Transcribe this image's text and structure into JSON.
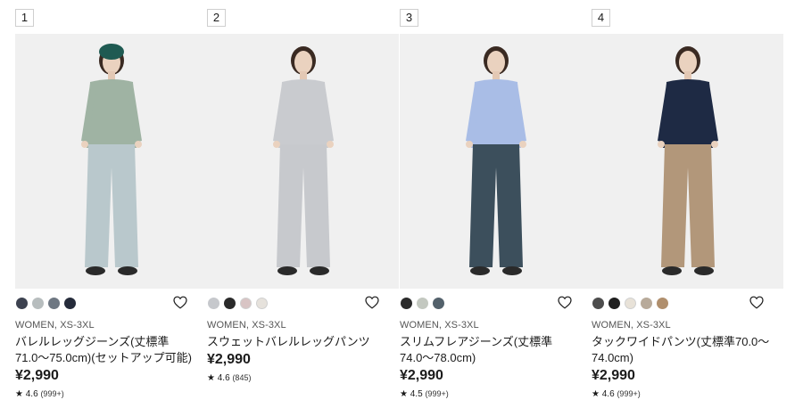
{
  "products": [
    {
      "rank": "1",
      "swatches": [
        "#3d4250",
        "#b7bdbe",
        "#6e7782",
        "#252b3a"
      ],
      "gender_size": "WOMEN, XS-3XL",
      "name": "バレルレッグジーンズ(丈標準71.0〜75.0cm)(セットアップ可能)",
      "price": "¥2,990",
      "rating_value": "4.6",
      "review_count": "(999+)",
      "top_color": "#9fb3a3",
      "bottom_color": "#b9c8cc",
      "hat_color": "#1f5a52"
    },
    {
      "rank": "2",
      "swatches": [
        "#c6c8cc",
        "#2a2a2a",
        "#d8c4c4",
        "#e6e2dc"
      ],
      "gender_size": "WOMEN, XS-3XL",
      "name": "スウェットバレルレッグパンツ",
      "price": "¥2,990",
      "rating_value": "4.6",
      "review_count": "(845)",
      "top_color": "#c9cbcf",
      "bottom_color": "#c7c9cd",
      "hat_color": ""
    },
    {
      "rank": "3",
      "swatches": [
        "#2b2b2b",
        "#c3c8c0",
        "#53616b"
      ],
      "gender_size": "WOMEN, XS-3XL",
      "name": "スリムフレアジーンズ(丈標準74.0〜78.0cm)",
      "price": "¥2,990",
      "rating_value": "4.5",
      "review_count": "(999+)",
      "top_color": "#a9bde6",
      "bottom_color": "#3c4f5c",
      "hat_color": ""
    },
    {
      "rank": "4",
      "swatches": [
        "#4d4d4d",
        "#1f1f1f",
        "#e8e2d8",
        "#b8aa9a",
        "#b08f6d"
      ],
      "gender_size": "WOMEN, XS-3XL",
      "name": "タックワイドパンツ(丈標準70.0〜74.0cm)",
      "price": "¥2,990",
      "rating_value": "4.6",
      "review_count": "(999+)",
      "top_color": "#1e2a44",
      "bottom_color": "#b2977a",
      "hat_color": ""
    }
  ]
}
